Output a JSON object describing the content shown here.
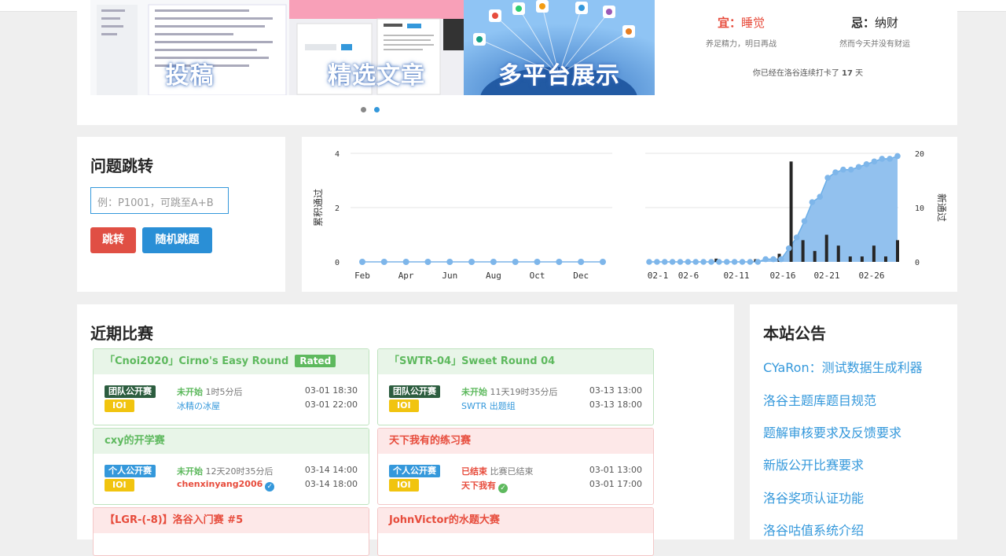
{
  "banner": {
    "slides": [
      {
        "caption": "投稿"
      },
      {
        "caption": "精选文章"
      },
      {
        "caption": "多平台展示"
      }
    ],
    "fortune": {
      "good_label": "宜",
      "good_value": "睡觉",
      "good_desc": "养足精力，明日再战",
      "bad_label": "忌",
      "bad_value": "纳财",
      "bad_desc": "然而今天并没有财运",
      "streak_prefix": "你已经在洛谷连续打卡了",
      "streak_days": "17",
      "streak_suffix": "天"
    }
  },
  "jump": {
    "title": "问题跳转",
    "input_placeholder": "例：P1001，可跳至A+B",
    "jump_button": "跳转",
    "random_button": "随机跳题"
  },
  "chart_data": [
    {
      "type": "line",
      "ylabel": "累积通过",
      "ylim": [
        0,
        4
      ],
      "yticks": [
        "0",
        "2",
        "4"
      ],
      "x": [
        "Feb",
        "Apr",
        "Jun",
        "Aug",
        "Oct",
        "Dec"
      ],
      "values": [
        0,
        0,
        0,
        0,
        0,
        0,
        0,
        0,
        0,
        0,
        0,
        0
      ]
    },
    {
      "type": "bar",
      "ylabel": "新通过",
      "ylim": [
        0,
        20
      ],
      "yticks": [
        "0",
        "10",
        "20"
      ],
      "xticks": [
        "02-1",
        "02-6",
        "02-11",
        "02-16",
        "02-21",
        "02-26"
      ],
      "bar_values": [
        0,
        0,
        0,
        0,
        0,
        0,
        0,
        0,
        0,
        0,
        0,
        0,
        0,
        0,
        0,
        0,
        0,
        0.6,
        0,
        0,
        0,
        0,
        0,
        0,
        0,
        0,
        0,
        0.5,
        0,
        0,
        0,
        0,
        0,
        1.5,
        0,
        0,
        18.5,
        0,
        0,
        4,
        0,
        0,
        2,
        0,
        0,
        5,
        0,
        0,
        3,
        0,
        0,
        1,
        0,
        0,
        1,
        0,
        0,
        3,
        0,
        0,
        1,
        0,
        0,
        4
      ],
      "cumulative_values": [
        0,
        0,
        0,
        0,
        0,
        0,
        0,
        0,
        0,
        0,
        0,
        0,
        0,
        0,
        0,
        0.1,
        0.1,
        0.1,
        0.5,
        0.9,
        1.5,
        2.2,
        2.4,
        3.1,
        3.3,
        3.4,
        3.4,
        3.5,
        3.6,
        3.7,
        3.8,
        3.8,
        3.9
      ]
    }
  ],
  "contests": {
    "title": "近期比赛",
    "items": [
      {
        "name": "「Cnoi2020」Cirno's Easy Round",
        "rated": "Rated",
        "color": "green",
        "type": "团队公开赛",
        "type_color": "#2c5d3f",
        "mode": "IOI",
        "status": "未开始",
        "countdown": "1时5分后",
        "host": "冰精の冰屋",
        "start": "03-01 18:30",
        "end": "03-01 22:00"
      },
      {
        "name": "「SWTR-04」Sweet Round 04",
        "rated": "",
        "color": "green",
        "type": "团队公开赛",
        "type_color": "#2c5d3f",
        "mode": "IOI",
        "status": "未开始",
        "countdown": "11天19时35分后",
        "host": "SWTR 出题组",
        "start": "03-13 13:00",
        "end": "03-13 18:00"
      },
      {
        "name": "cxy的开学赛",
        "rated": "",
        "color": "green",
        "type": "个人公开赛",
        "type_color": "#3498db",
        "mode": "IOI",
        "status": "未开始",
        "countdown": "12天20时35分后",
        "host": "chenxinyang2006",
        "start": "03-14 14:00",
        "end": "03-14 18:00"
      },
      {
        "name": "天下我有的练习赛",
        "rated": "",
        "color": "red",
        "type": "个人公开赛",
        "type_color": "#3498db",
        "mode": "IOI",
        "status": "已结束",
        "countdown": "比赛已结束",
        "host": "天下我有",
        "start": "03-01 13:00",
        "end": "03-01 17:00"
      },
      {
        "name": "【LGR-(-8)】洛谷入门赛 #5",
        "color": "red"
      },
      {
        "name": "JohnVictor的水题大赛",
        "color": "red"
      }
    ]
  },
  "announcements": {
    "title": "本站公告",
    "items": [
      "CYaRon：测试数据生成利器",
      "洛谷主题库题目规范",
      "题解审核要求及反馈要求",
      "新版公开比赛要求",
      "洛谷奖项认证功能",
      "洛谷咕值系统介绍"
    ]
  },
  "colors": {
    "accent": "#3498db",
    "danger": "#e74c3c",
    "success": "#5eb95e",
    "warning": "#f1c40f"
  }
}
